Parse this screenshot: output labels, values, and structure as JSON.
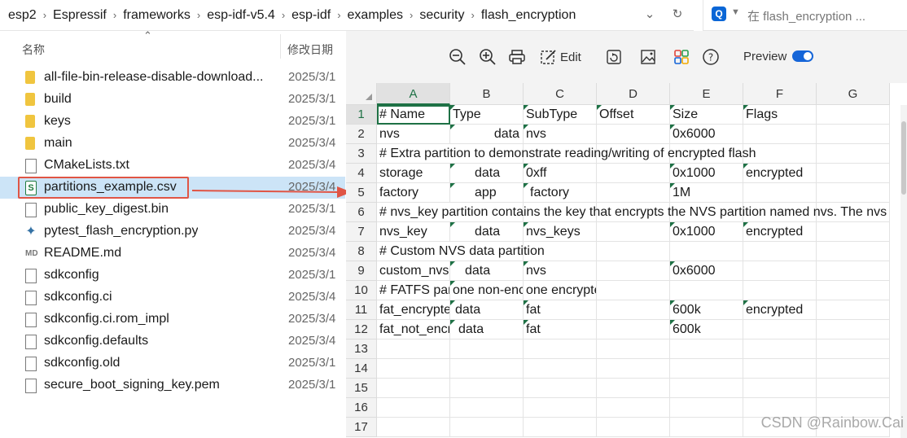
{
  "breadcrumb": [
    "esp2",
    "Espressif",
    "frameworks",
    "esp-idf-v5.4",
    "esp-idf",
    "examples",
    "security",
    "flash_encryption"
  ],
  "search": {
    "placeholder": "在 flash_encryption ..."
  },
  "file_list": {
    "header_name": "名称",
    "header_date": "修改日期",
    "items": [
      {
        "name": "all-file-bin-release-disable-download...",
        "date": "2025/3/1",
        "icon": "folder-icon"
      },
      {
        "name": "build",
        "date": "2025/3/1",
        "icon": "folder-icon"
      },
      {
        "name": "keys",
        "date": "2025/3/1",
        "icon": "folder-icon"
      },
      {
        "name": "main",
        "date": "2025/3/4",
        "icon": "folder-icon"
      },
      {
        "name": "CMakeLists.txt",
        "date": "2025/3/4",
        "icon": "text-file-icon"
      },
      {
        "name": "partitions_example.csv",
        "date": "2025/3/4",
        "icon": "csv-file-icon",
        "selected": true
      },
      {
        "name": "public_key_digest.bin",
        "date": "2025/3/1",
        "icon": "binary-file-icon"
      },
      {
        "name": "pytest_flash_encryption.py",
        "date": "2025/3/4",
        "icon": "python-file-icon"
      },
      {
        "name": "README.md",
        "date": "2025/3/4",
        "icon": "markdown-file-icon"
      },
      {
        "name": "sdkconfig",
        "date": "2025/3/1",
        "icon": "file-icon"
      },
      {
        "name": "sdkconfig.ci",
        "date": "2025/3/4",
        "icon": "file-icon"
      },
      {
        "name": "sdkconfig.ci.rom_impl",
        "date": "2025/3/4",
        "icon": "file-icon"
      },
      {
        "name": "sdkconfig.defaults",
        "date": "2025/3/4",
        "icon": "file-icon"
      },
      {
        "name": "sdkconfig.old",
        "date": "2025/3/1",
        "icon": "file-icon"
      },
      {
        "name": "secure_boot_signing_key.pem",
        "date": "2025/3/1",
        "icon": "file-icon"
      }
    ]
  },
  "toolbar": {
    "edit_label": "Edit",
    "preview_label": "Preview",
    "preview_on": true,
    "icons": [
      "zoom-out-icon",
      "zoom-in-icon",
      "print-icon",
      "edit-icon",
      "rotate-icon",
      "image-icon",
      "apps-icon",
      "help-icon"
    ]
  },
  "spreadsheet": {
    "columns": [
      "A",
      "B",
      "C",
      "D",
      "E",
      "F",
      "G"
    ],
    "active_column": "A",
    "active_row": 1,
    "row_numbers": [
      "1",
      "2",
      "3",
      "4",
      "5",
      "6",
      "7",
      "8",
      "9",
      "10",
      "11",
      "12",
      "13",
      "14",
      "15",
      "16",
      "17"
    ],
    "rows": [
      [
        "# Name",
        " Type",
        "SubType",
        "Offset",
        " Size",
        " Flags",
        ""
      ],
      [
        "nvs",
        "data",
        "nvs",
        "",
        "0x6000",
        "",
        ""
      ],
      [
        "# Extra partition to demonstrate reading/writing of encrypted flash",
        "",
        "",
        "",
        "",
        "",
        ""
      ],
      [
        "storage",
        "data",
        "0xff",
        "",
        "0x1000",
        "encrypted",
        ""
      ],
      [
        "factory",
        "app",
        "factory",
        "",
        "1M",
        "",
        ""
      ],
      [
        "# nvs_key partition contains the key that encrypts the NVS partition named nvs. The nvs",
        "",
        "",
        "",
        "",
        "",
        ""
      ],
      [
        "nvs_key",
        "data",
        "nvs_keys",
        "",
        "0x1000",
        "encrypted",
        ""
      ],
      [
        "# Custom NVS data partition",
        "",
        "",
        "",
        "",
        "",
        ""
      ],
      [
        "custom_nvs",
        "data",
        "nvs",
        "",
        "0x6000",
        "",
        ""
      ],
      [
        "# FATFS partition with",
        "one non-encrypted",
        "one encrypted",
        "",
        "",
        "",
        ""
      ],
      [
        "fat_encrypted",
        "data",
        "fat",
        "",
        "600k",
        "  encrypted",
        ""
      ],
      [
        "fat_not_encrypted",
        "data",
        "fat",
        "",
        "600k",
        "",
        ""
      ],
      [
        "",
        "",
        "",
        "",
        "",
        "",
        ""
      ],
      [
        "",
        "",
        "",
        "",
        "",
        "",
        ""
      ],
      [
        "",
        "",
        "",
        "",
        "",
        "",
        ""
      ],
      [
        "",
        "",
        "",
        "",
        "",
        "",
        ""
      ],
      [
        "",
        "",
        "",
        "",
        "",
        "",
        ""
      ]
    ]
  },
  "watermark": "CSDN @Rainbow.Cai",
  "colors": {
    "accent": "#1e7145",
    "highlight": "#e05545",
    "toggle": "#1565d8"
  }
}
